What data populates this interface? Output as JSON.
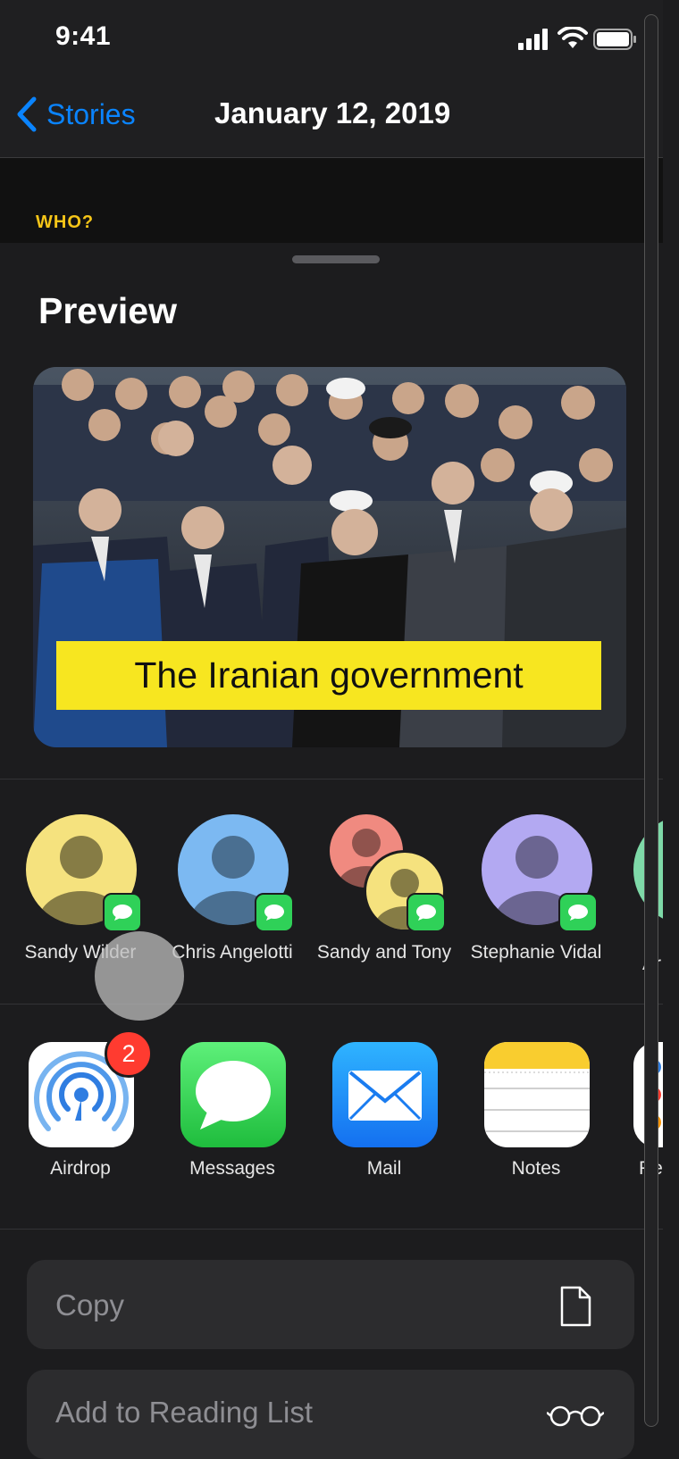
{
  "status_bar": {
    "time": "9:41"
  },
  "nav": {
    "back_label": "Stories",
    "title": "January 12, 2019"
  },
  "section_label": "WHO?",
  "sheet": {
    "title": "Preview",
    "preview": {
      "caption": "The Iranian government"
    },
    "contacts": [
      {
        "name": "Sandy Wilder",
        "avatar_color": "#f5e27e"
      },
      {
        "name": "Chris Angelotti",
        "avatar_color": "#7cb9f2"
      },
      {
        "name": "Sandy and Tony",
        "avatar_color": "#f08a80"
      },
      {
        "name": "Stephanie Vidal",
        "avatar_color": "#b3a9f2"
      },
      {
        "name": "Ar",
        "avatar_color": "#7ed9a8"
      }
    ],
    "apps": [
      {
        "name": "Airdrop",
        "icon": "airdrop-icon",
        "badge": "2"
      },
      {
        "name": "Messages",
        "icon": "messages-icon"
      },
      {
        "name": "Mail",
        "icon": "mail-icon"
      },
      {
        "name": "Notes",
        "icon": "notes-icon"
      },
      {
        "name": "Re",
        "icon": "reminders-icon"
      }
    ],
    "actions": [
      {
        "label": "Copy",
        "icon": "document-icon"
      },
      {
        "label": "Add to Reading List",
        "icon": "glasses-icon"
      }
    ]
  },
  "colors": {
    "accent": "#0a84ff",
    "who_label": "#f5c518",
    "caption_bg": "#f7e620",
    "messages_green": "#2fd158",
    "badge_red": "#ff3b30"
  }
}
